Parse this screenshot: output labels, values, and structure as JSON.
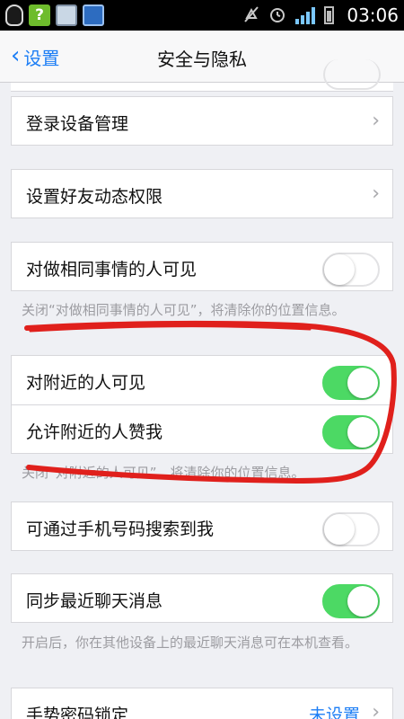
{
  "status_bar": {
    "time": "03:06",
    "icons": [
      "qq-icon",
      "question-app-icon",
      "chart-app-icon",
      "book-app-icon",
      "mute-icon",
      "alarm-icon",
      "signal-icon",
      "battery-icon"
    ],
    "q_glyph": "?"
  },
  "nav": {
    "back_label": "设置",
    "title": "安全与隐私"
  },
  "cells": {
    "device_mgmt": "登录设备管理",
    "friend_perm": "设置好友动态权限",
    "same_thing": "对做相同事情的人可见",
    "nearby_visible": "对附近的人可见",
    "nearby_like": "允许附近的人赞我",
    "phone_search": "可通过手机号码搜索到我",
    "sync_chat": "同步最近聊天消息",
    "gesture_lock": "手势密码锁定",
    "gesture_value": "未设置"
  },
  "toggles": {
    "same_thing": false,
    "nearby_visible": true,
    "nearby_like": true,
    "phone_search": false,
    "sync_chat": true
  },
  "notes": {
    "same_thing": "关闭“对做相同事情的人可见”，将清除你的位置信息。",
    "nearby": "关闭“对附近的人可见”，将清除你的位置信息。",
    "sync": "开启后，你在其他设备上的最近聊天消息可在本机查看。"
  },
  "colors": {
    "accent": "#1d7ef5",
    "toggle_on": "#4cd964",
    "scribble": "#e0201c"
  }
}
